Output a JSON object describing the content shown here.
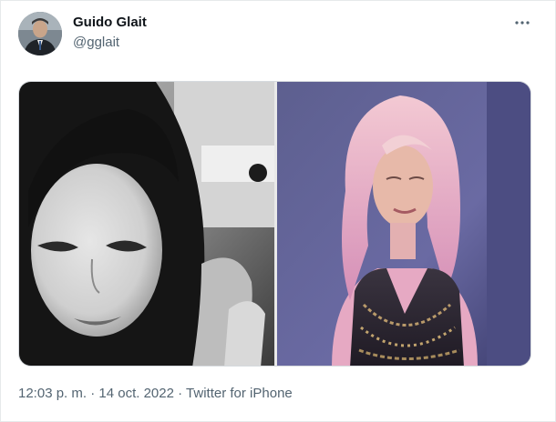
{
  "author": {
    "display_name": "Guido Glait",
    "handle": "@gglait",
    "avatar_icon": "user-avatar"
  },
  "menu": {
    "icon": "more-horizontal-icon"
  },
  "media": {
    "count": 2,
    "photos": [
      {
        "icon": "photo",
        "tone": "black-and-white"
      },
      {
        "icon": "photo",
        "tone": "color"
      }
    ]
  },
  "meta": {
    "time": "12:03 p. m.",
    "separator": " · ",
    "date": "14 oct. 2022",
    "source": "Twitter for iPhone"
  },
  "colors": {
    "text_primary": "#0f1419",
    "text_secondary": "#536471",
    "border": "#e6e9ea"
  }
}
